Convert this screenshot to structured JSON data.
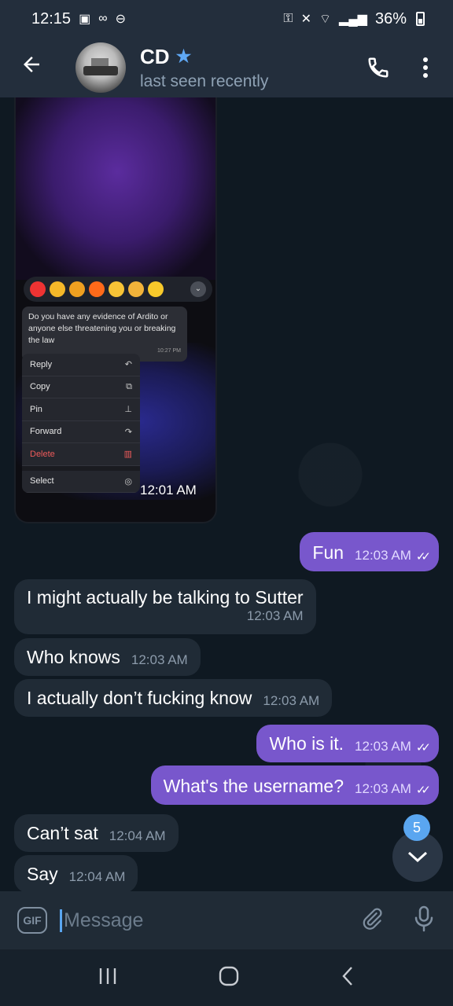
{
  "status_bar": {
    "time": "12:15",
    "battery": "36%"
  },
  "header": {
    "name": "CD",
    "status": "last seen recently"
  },
  "image_message": {
    "quoted_text": "Do you have any evidence of Ardito or anyone else threatening you or breaking the law",
    "quoted_time": "10:27 PM",
    "menu": [
      "Reply",
      "Copy",
      "Pin",
      "Forward",
      "Delete",
      "Select"
    ],
    "time": "12:01 AM"
  },
  "messages": [
    {
      "dir": "out",
      "text": "Fun",
      "time": "12:03 AM"
    },
    {
      "dir": "in",
      "text": "I might actually be talking to Sutter",
      "time": "12:03 AM"
    },
    {
      "dir": "in",
      "text": "Who knows",
      "time": "12:03 AM"
    },
    {
      "dir": "in",
      "text": "I actually don’t fucking know",
      "time": "12:03 AM"
    },
    {
      "dir": "out",
      "text": "Who is it.",
      "time": "12:03 AM"
    },
    {
      "dir": "out",
      "text": "What's the username?",
      "time": "12:03 AM"
    },
    {
      "dir": "in",
      "text": "Can’t sat",
      "time": "12:04 AM"
    },
    {
      "dir": "in",
      "text": "Say",
      "time": "12:04 AM"
    }
  ],
  "unread_count": "5",
  "composer": {
    "gif_label": "GIF",
    "placeholder": "Message"
  },
  "colors": {
    "accent": "#7857cc",
    "header": "#232e3c",
    "badge": "#5aa6f0"
  },
  "icons": [
    "back-arrow-icon",
    "star-icon",
    "phone-icon",
    "more-vert-icon",
    "chevron-down-icon",
    "attach-icon",
    "mic-icon"
  ]
}
